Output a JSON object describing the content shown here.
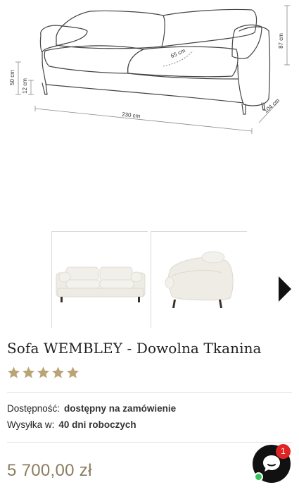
{
  "diagram": {
    "dims": {
      "height_back": "87 cm",
      "seat_depth": "65 cm",
      "seat_height": "50 cm",
      "leg_height": "12 cm",
      "width": "230 cm",
      "depth": "104 cm"
    }
  },
  "gallery": {
    "thumbnails": [
      "sofa-front-view",
      "sofa-side-view"
    ],
    "next_icon": "next-arrow-icon"
  },
  "product": {
    "title": "Sofa WEMBLEY - Dowolna Tkanina",
    "rating": 5,
    "rating_max": 5,
    "availability_label": "Dostępność:",
    "availability_value": "dostępny na zamówienie",
    "shipping_label": "Wysyłka w:",
    "shipping_value": "40 dni roboczych",
    "price": "5 700,00 zł"
  },
  "chat": {
    "badge": "1",
    "icon": "chat-bubble-icon"
  },
  "colors": {
    "star": "#b9a476",
    "price": "#8c7d5f",
    "badge": "#e02424",
    "online": "#3bc45a"
  }
}
